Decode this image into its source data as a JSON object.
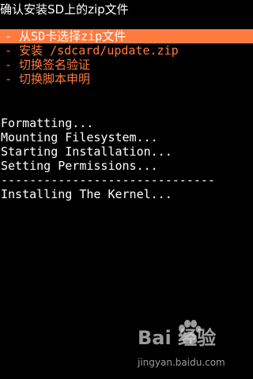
{
  "header": {
    "title": "确认安装SD上的zip文件"
  },
  "menu": {
    "items": [
      {
        "label": "- 从SD卡选择zip文件",
        "selected": true
      },
      {
        "label": "- 安装 /sdcard/update.zip",
        "selected": false
      },
      {
        "label": "- 切换签名验证",
        "selected": false
      },
      {
        "label": "- 切换脚本申明",
        "selected": false
      }
    ]
  },
  "log": {
    "lines": [
      "Formatting...",
      "Mounting Filesystem...",
      "Starting Installation...",
      "Setting Permissions..."
    ],
    "divider": "------------------------------",
    "status": "Installing The Kernel..."
  },
  "watermark": {
    "logo_text": "Bai  经验",
    "url": "jingyan.baidu.com"
  },
  "colors": {
    "background": "#000000",
    "text": "#ffffff",
    "accent": "#ff7a3f"
  }
}
